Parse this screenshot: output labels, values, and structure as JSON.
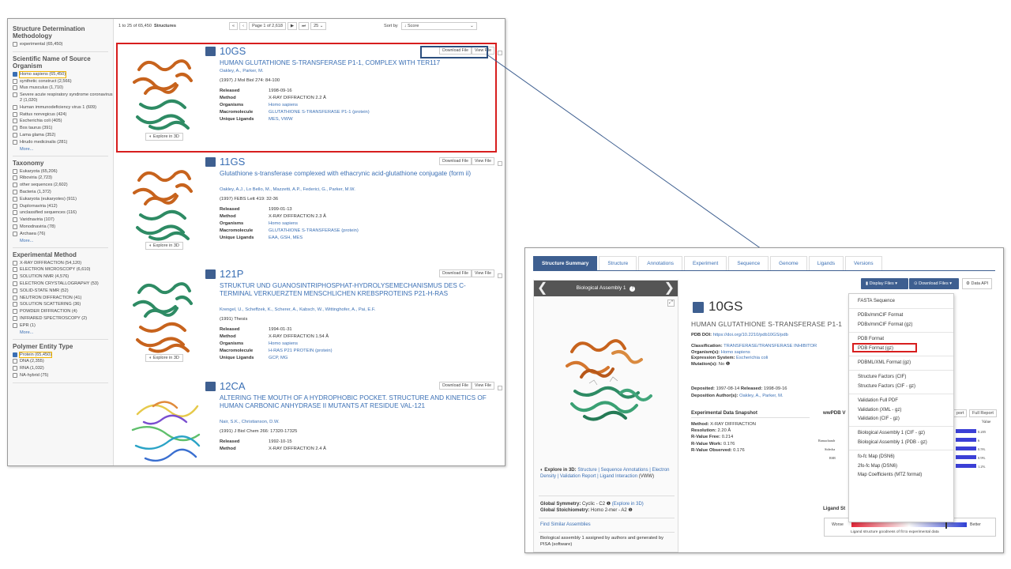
{
  "search": {
    "sidebar": {
      "groups": [
        {
          "title": "Structure Determination Methodology",
          "items": [
            {
              "label": "experimental (65,450)",
              "checked": false
            }
          ],
          "more": ""
        },
        {
          "title": "Scientific Name of Source Organism",
          "items": [
            {
              "label": "Homo sapiens (65,450)",
              "checked": true
            },
            {
              "label": "synthetic construct (2,566)",
              "checked": false
            },
            {
              "label": "Mus musculus (1,710)",
              "checked": false
            },
            {
              "label": "Severe acute respiratory syndrome coronavirus 2 (1,020)",
              "checked": false
            },
            {
              "label": "Human immunodeficiency virus 1 (609)",
              "checked": false
            },
            {
              "label": "Rattus norvegicus (424)",
              "checked": false
            },
            {
              "label": "Escherichia coli (405)",
              "checked": false
            },
            {
              "label": "Bos taurus (391)",
              "checked": false
            },
            {
              "label": "Lama glama (352)",
              "checked": false
            },
            {
              "label": "Hirudo medicinalis (281)",
              "checked": false
            }
          ],
          "more": "More..."
        },
        {
          "title": "Taxonomy",
          "items": [
            {
              "label": "Eukaryota (65,206)",
              "checked": false
            },
            {
              "label": "Riboviria (2,723)",
              "checked": false
            },
            {
              "label": "other sequences (2,602)",
              "checked": false
            },
            {
              "label": "Bacteria (1,372)",
              "checked": false
            },
            {
              "label": "Eukaryota (eukaryotes) (911)",
              "checked": false
            },
            {
              "label": "Duplornaviria (412)",
              "checked": false
            },
            {
              "label": "unclassified sequences (116)",
              "checked": false
            },
            {
              "label": "Varidnaviria (107)",
              "checked": false
            },
            {
              "label": "Monodnaviria (78)",
              "checked": false
            },
            {
              "label": "Archaea (76)",
              "checked": false
            }
          ],
          "more": "More..."
        },
        {
          "title": "Experimental Method",
          "items": [
            {
              "label": "X-RAY DIFFRACTION (54,120)",
              "checked": false
            },
            {
              "label": "ELECTRON MICROSCOPY (6,610)",
              "checked": false
            },
            {
              "label": "SOLUTION NMR (4,576)",
              "checked": false
            },
            {
              "label": "ELECTRON CRYSTALLOGRAPHY (53)",
              "checked": false
            },
            {
              "label": "SOLID-STATE NMR (52)",
              "checked": false
            },
            {
              "label": "NEUTRON DIFFRACTION (41)",
              "checked": false
            },
            {
              "label": "SOLUTION SCATTERING (36)",
              "checked": false
            },
            {
              "label": "POWDER DIFFRACTION (4)",
              "checked": false
            },
            {
              "label": "INFRARED SPECTROSCOPY (2)",
              "checked": false
            },
            {
              "label": "EPR (1)",
              "checked": false
            }
          ],
          "more": "More..."
        },
        {
          "title": "Polymer Entity Type",
          "items": [
            {
              "label": "Protein (65,450)",
              "checked": true
            },
            {
              "label": "DNA (2,355)",
              "checked": false
            },
            {
              "label": "RNA (1,032)",
              "checked": false
            },
            {
              "label": "NA-hybrid (75)",
              "checked": false
            }
          ],
          "more": ""
        }
      ]
    },
    "toolbar": {
      "count_prefix": "1 to 25 of 65,450",
      "count_suffix": "Structures",
      "page_label": "Page 1 of 2,618",
      "per_page": "25",
      "sort_label": "Sort by",
      "sort_value": "↓ Score"
    },
    "entries": [
      {
        "id": "10GS",
        "title": "HUMAN GLUTATHIONE S-TRANSFERASE P1-1, COMPLEX WITH TER117",
        "authors": "Oakley, A., Parker, M.",
        "citation": "(1997) J Mol Biol 274: 84-100",
        "rows": [
          [
            "Released",
            "1998-09-16"
          ],
          [
            "Method",
            "X-RAY DIFFRACTION 2.2 Å"
          ],
          [
            "Organisms",
            "Homo sapiens"
          ],
          [
            "Macromolecule",
            "GLUTATHIONE S-TRANSFERASE P1-1 (protein)"
          ],
          [
            "Unique Ligands",
            "MES, VWW"
          ]
        ]
      },
      {
        "id": "11GS",
        "title": "Glutathione s-transferase complexed with ethacrynic acid-glutathione conjugate (form ii)",
        "authors": "Oakley, A.J., Lo Bello, M., Mazzetti, A.P., Federici, G., Parker, M.W.",
        "citation": "(1997) FEBS Lett 419: 32-36",
        "rows": [
          [
            "Released",
            "1999-01-13"
          ],
          [
            "Method",
            "X-RAY DIFFRACTION 2.3 Å"
          ],
          [
            "Organisms",
            "Homo sapiens"
          ],
          [
            "Macromolecule",
            "GLUTATHIONE S-TRANSFERASE (protein)"
          ],
          [
            "Unique Ligands",
            "EAA, GSH, MES"
          ]
        ]
      },
      {
        "id": "121P",
        "title": "STRUKTUR UND GUANOSINTRIPHOSPHAT-HYDROLYSEMECHANISMUS DES C-TERMINAL VERKUERZTEN MENSCHLICHEN KREBSPROTEINS P21-H-RAS",
        "authors": "Krengel, U., Scheffzek, K., Scherer, A., Kabsch, W., Wittinghofer, A., Pai, E.F.",
        "citation": "(1991) Thesis",
        "rows": [
          [
            "Released",
            "1994-01-31"
          ],
          [
            "Method",
            "X-RAY DIFFRACTION 1.54 Å"
          ],
          [
            "Organisms",
            "Homo sapiens"
          ],
          [
            "Macromolecule",
            "H-RAS P21 PROTEIN (protein)"
          ],
          [
            "Unique Ligands",
            "GCP, MG"
          ]
        ]
      },
      {
        "id": "12CA",
        "title": "ALTERING THE MOUTH OF A HYDROPHOBIC POCKET. STRUCTURE AND KINETICS OF HUMAN CARBONIC ANHYDRASE II MUTANTS AT RESIDUE VAL-121",
        "authors": "Nair, S.K., Christianson, D.W.",
        "citation": "(1991) J Biol Chem 266: 17320-17325",
        "rows": [
          [
            "Released",
            "1992-10-15"
          ],
          [
            "Method",
            "X-RAY DIFFRACTION 2.4 Å"
          ]
        ]
      }
    ],
    "download_file": "Download File",
    "view_file": "View File",
    "explore_3d": "Explore in 3D"
  },
  "detail": {
    "tabs": [
      "Structure Summary",
      "Structure",
      "Annotations",
      "Experiment",
      "Sequence",
      "Genome",
      "Ligands",
      "Versions"
    ],
    "viewer_title": "Biological Assembly 1",
    "id": "10GS",
    "title": "HUMAN GLUTATHIONE S-TRANSFERASE P1-1",
    "doi_label": "PDB DOI:",
    "doi": "https://doi.org/10.2210/pdb10GS/pdb",
    "classification_label": "Classification:",
    "classification": "TRANSFERASE/TRANSFERASE INHIBITOR",
    "organism_label": "Organism(s):",
    "organism": "Homo sapiens",
    "expression_label": "Expression System:",
    "expression": "Escherichia coli",
    "mutation_label": "Mutation(s):",
    "mutation": "No",
    "deposited_label": "Deposited:",
    "deposited": "1997-08-14",
    "released_label": "Released:",
    "released": "1998-09-16",
    "depositor_label": "Deposition Author(s):",
    "depositors": "Oakley, A., Parker, M.",
    "snapshot_title": "Experimental Data Snapshot",
    "snapshot": [
      [
        "Method:",
        "X-RAY DIFFRACTION"
      ],
      [
        "Resolution:",
        "2.20 Å"
      ],
      [
        "R-Value Free:",
        "0.214"
      ],
      [
        "R-Value Work:",
        "0.176"
      ],
      [
        "R-Value Observed:",
        "0.176"
      ]
    ],
    "wwpdb_label": "wwPDB V",
    "report_btn": "port",
    "full_report": "Full Report",
    "explore_3d_label": "Explore in 3D:",
    "explore_links": "Structure | Sequence Annotations | Electron Density | Validation Report | Ligand Interaction",
    "explore_tail": "(VWW)",
    "global_symmetry_label": "Global Symmetry:",
    "global_symmetry": "Cyclic - C2",
    "explore_link": "(Explore in 3D)",
    "global_stoich_label": "Global Stoichiometry:",
    "global_stoich": "Homo 2-mer - A2",
    "find_similar": "Find Similar Assemblies",
    "assembly_note": "Biological assembly 1 assigned by authors and generated by PISA (software)",
    "display_files": "Display Files",
    "download_files": "Download Files",
    "data_api": "Data API",
    "dropdown_groups": [
      [
        "FASTA Sequence"
      ],
      [
        "PDBx/mmCIF Format",
        "PDBx/mmCIF Format (gz)"
      ],
      [
        "PDB Format",
        "PDB Format (gz)"
      ],
      [
        "PDBML/XML Format (gz)"
      ],
      [
        "Structure Factors (CIF)",
        "Structure Factors (CIF - gz)"
      ],
      [
        "Validation Full PDF",
        "Validation (XML - gz)",
        "Validation (CIF - gz)"
      ],
      [
        "Biological Assembly 1 (CIF - gz)",
        "Biological Assembly 1 (PDB - gz)"
      ],
      [
        "fo-fc Map (DSN6)",
        "2fo-fc Map (DSN6)",
        "Map Coefficients (MTZ format)"
      ]
    ],
    "ligand_label": "Ligand St",
    "worse": "Worse",
    "better": "Better",
    "ligand_caption": "Ligand structure goodness of fit to experimental data",
    "value_label": "Value",
    "partial_labels": [
      "Ramachandr",
      "Sidecha",
      "RSR"
    ],
    "val_numbers": [
      "0.205",
      "6",
      "0.5%",
      "0.9%",
      "1.2%"
    ]
  }
}
